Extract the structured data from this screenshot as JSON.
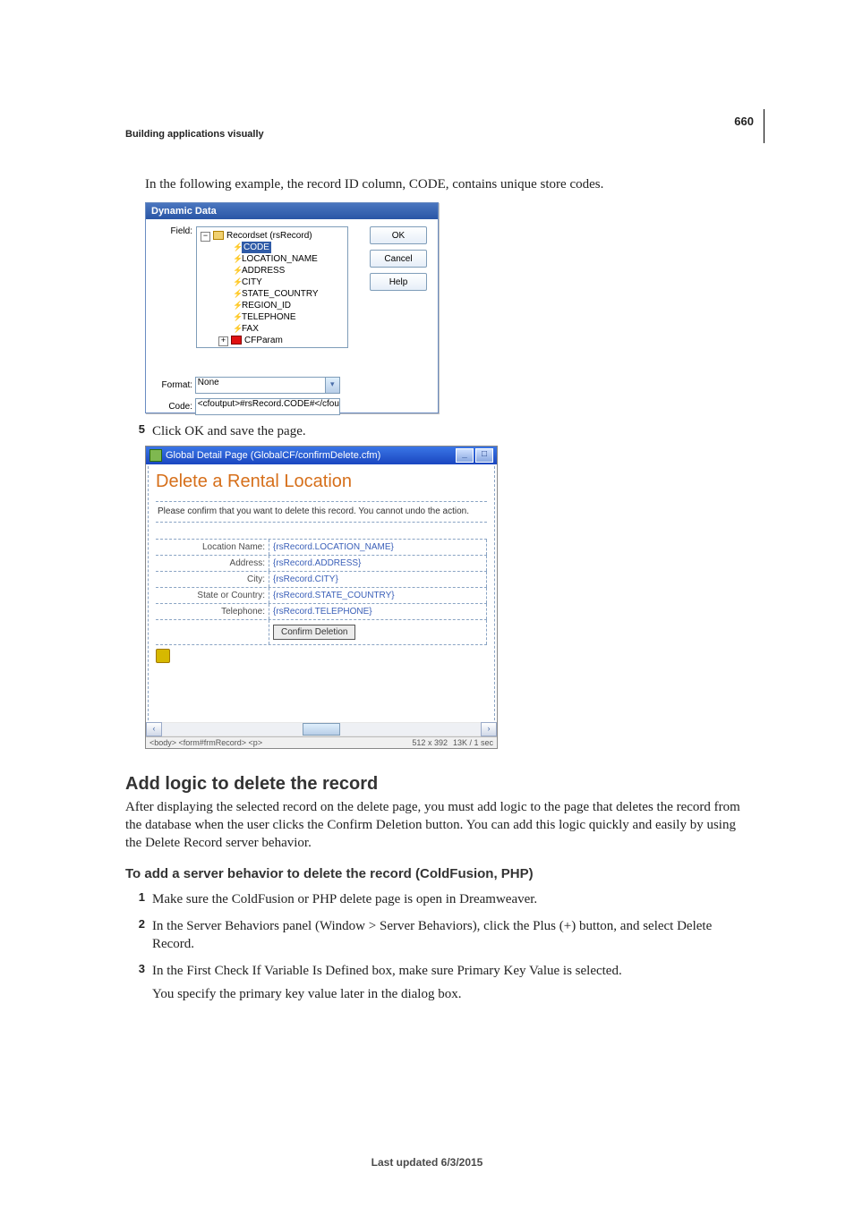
{
  "page_number": "660",
  "breadcrumb": "Building applications visually",
  "intro_line": "In the following example, the record ID column, CODE, contains unique store codes.",
  "dlg1": {
    "title": "Dynamic Data",
    "field_label": "Field:",
    "tree_root": "Recordset (rsRecord)",
    "tree_items": [
      "CODE",
      "LOCATION_NAME",
      "ADDRESS",
      "CITY",
      "STATE_COUNTRY",
      "REGION_ID",
      "TELEPHONE",
      "FAX"
    ],
    "tree_sibling": "CFParam",
    "format_label": "Format:",
    "format_value": "None",
    "code_label": "Code:",
    "code_value": "<cfoutput>#rsRecord.CODE#</cfoutput>",
    "btn_ok": "OK",
    "btn_cancel": "Cancel",
    "btn_help": "Help"
  },
  "step5_num": "5",
  "step5_text": "Click OK and save the page.",
  "win2": {
    "title": "Global Detail Page (GlobalCF/confirmDelete.cfm)",
    "doc_heading": "Delete a Rental Location",
    "doc_para": "Please confirm that you want to delete this record. You cannot undo the action.",
    "rows": [
      {
        "label": "Location Name:",
        "value": "{rsRecord.LOCATION_NAME}"
      },
      {
        "label": "Address:",
        "value": "{rsRecord.ADDRESS}"
      },
      {
        "label": "City:",
        "value": "{rsRecord.CITY}"
      },
      {
        "label": "State or Country:",
        "value": "{rsRecord.STATE_COUNTRY}"
      },
      {
        "label": "Telephone:",
        "value": "{rsRecord.TELEPHONE}"
      }
    ],
    "btn_confirm": "Confirm Deletion",
    "status_path": "<body> <form#frmRecord> <p>",
    "status_size": "512 x 392",
    "status_meta": "13K / 1 sec"
  },
  "sec": {
    "heading": "Add logic to delete the record",
    "body": "After displaying the selected record on the delete page, you must add logic to the page that deletes the record from the database when the user clicks the Confirm Deletion button. You can add this logic quickly and easily by using the Delete Record server behavior.",
    "sub_heading": "To add a server behavior to delete the record (ColdFusion, PHP)",
    "steps": [
      {
        "n": "1",
        "t": "Make sure the ColdFusion or PHP delete page is open in Dreamweaver."
      },
      {
        "n": "2",
        "t": "In the Server Behaviors panel (Window > Server Behaviors), click the Plus (+) button, and select Delete Record."
      },
      {
        "n": "3",
        "t": "In the First Check If Variable Is Defined box, make sure Primary Key Value is selected."
      }
    ],
    "step3_sub": "You specify the primary key value later in the dialog box."
  },
  "footer": "Last updated 6/3/2015"
}
